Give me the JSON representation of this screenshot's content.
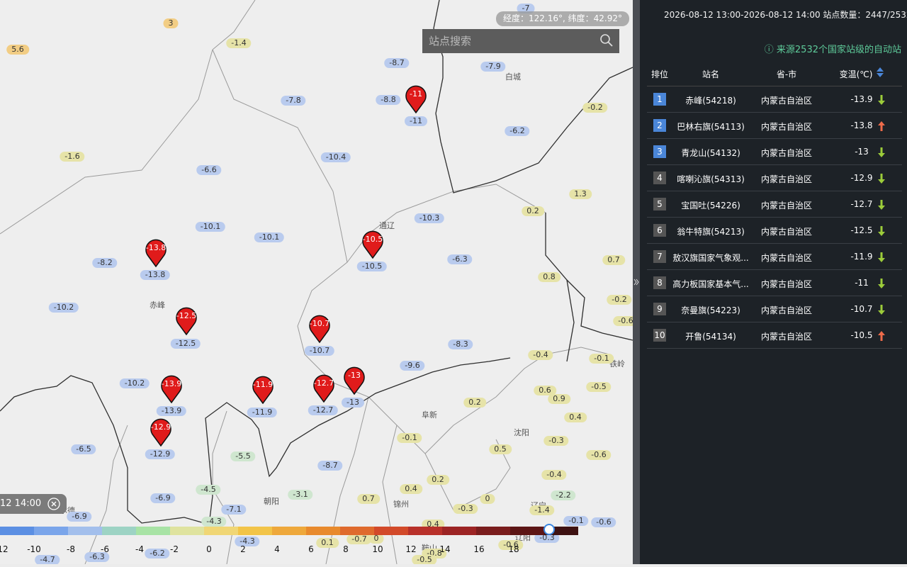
{
  "coord_readout": "经度：122.16°, 纬度：42.92°",
  "search": {
    "placeholder": "站点搜索"
  },
  "time_chip": {
    "label": "12 14:00"
  },
  "legend": {
    "colors": [
      "#5b8fe3",
      "#7aa5ea",
      "#a3bfec",
      "#9dd3c4",
      "#a8e3a5",
      "#dfe39f",
      "#f0d675",
      "#f2c448",
      "#eea83b",
      "#e88a2d",
      "#df6a2d",
      "#d24a2a",
      "#b8312a",
      "#9c2424",
      "#7a1d1d",
      "#5c1515",
      "#3e1212"
    ],
    "ticks": [
      "12",
      "-10",
      "-8",
      "-6",
      "-4",
      "-2",
      "0",
      "2",
      "4",
      "6",
      "8",
      "10",
      "12",
      "14",
      "16",
      "18"
    ]
  },
  "map": {
    "cities": [
      "白城",
      "通辽",
      "赤峰",
      "阜新",
      "沈阳",
      "铁岭",
      "朝阳",
      "锦州",
      "辽宁",
      "承德",
      "辽阳",
      "鞍山"
    ],
    "values": [
      "-7",
      "3",
      "5.6",
      "-1.4",
      "-8.7",
      "-7.9",
      "-8.8",
      "-11",
      "-7.8",
      "-0.2",
      "-6.2",
      "-1.6",
      "-10.4",
      "-6.6",
      "1.3",
      "0.2",
      "-10.3",
      "-10.1",
      "-10.1",
      "-8.2",
      "-13.8",
      "-10.5",
      "-6.3",
      "0.7",
      "0.8",
      "-10.2",
      "-0.2",
      "-0.6",
      "-12.5",
      "-10.7",
      "-8.3",
      "-0.4",
      "-0.1",
      "-9.6",
      "-10.2",
      "-13.9",
      "-11.9",
      "-12.7",
      "-13",
      "0.6",
      "-0.5",
      "0.9",
      "0.2",
      "0.4",
      "-12.9",
      "-6.5",
      "-0.1",
      "0.5",
      "-0.3",
      "-0.6",
      "-5.5",
      "-8.7",
      "-0.4",
      "-4.5",
      "-6.9",
      "-3.1",
      "0.4",
      "0.2",
      "-2.2",
      "-7.1",
      "0.7",
      "0",
      "-0.3",
      "-1.4",
      "-6.9",
      "-4.3",
      "-0.1",
      "-0.6",
      "0.4",
      "-4.7",
      "-0.3",
      "-6.2",
      "-4.3",
      "0.1",
      "-0.7",
      "0",
      "-0.6",
      "-0.8",
      "-6.3",
      "-4.7",
      "-0.5"
    ],
    "pins": [
      "-11",
      "-13.8",
      "-10.5",
      "-12.5",
      "-10.7",
      "-13.9",
      "-11.9",
      "-12.7",
      "-13",
      "-12.9"
    ]
  },
  "panel": {
    "header": "2026-08-12 13:00-2026-08-12 14:00  站点数量：2447/2532",
    "source": "来源2532个国家站级的自动站",
    "columns": {
      "rank": "排位",
      "station": "站名",
      "province": "省-市",
      "change": "变温(℃)"
    },
    "rows": [
      {
        "rank": "1",
        "station": "赤峰(54218)",
        "province": "内蒙古自治区",
        "change": "-13.9",
        "trend": "down"
      },
      {
        "rank": "2",
        "station": "巴林右旗(54113)",
        "province": "内蒙古自治区",
        "change": "-13.8",
        "trend": "up"
      },
      {
        "rank": "3",
        "station": "青龙山(54132)",
        "province": "内蒙古自治区",
        "change": "-13",
        "trend": "down"
      },
      {
        "rank": "4",
        "station": "喀喇沁旗(54313)",
        "province": "内蒙古自治区",
        "change": "-12.9",
        "trend": "down"
      },
      {
        "rank": "5",
        "station": "宝国吐(54226)",
        "province": "内蒙古自治区",
        "change": "-12.7",
        "trend": "down"
      },
      {
        "rank": "6",
        "station": "翁牛特旗(54213)",
        "province": "内蒙古自治区",
        "change": "-12.5",
        "trend": "down"
      },
      {
        "rank": "7",
        "station": "敖汉旗国家气象观...",
        "province": "内蒙古自治区",
        "change": "-11.9",
        "trend": "down"
      },
      {
        "rank": "8",
        "station": "高力板国家基本气...",
        "province": "内蒙古自治区",
        "change": "-11",
        "trend": "down"
      },
      {
        "rank": "9",
        "station": "奈曼旗(54223)",
        "province": "内蒙古自治区",
        "change": "-10.7",
        "trend": "down"
      },
      {
        "rank": "10",
        "station": "开鲁(54134)",
        "province": "内蒙古自治区",
        "change": "-10.5",
        "trend": "up"
      }
    ]
  }
}
